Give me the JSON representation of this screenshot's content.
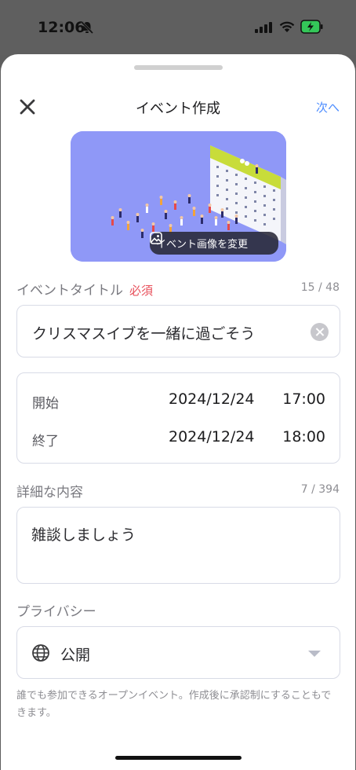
{
  "status": {
    "time": "12:06"
  },
  "header": {
    "title": "イベント作成",
    "next_label": "次へ"
  },
  "image": {
    "change_label": "イベント画像を変更"
  },
  "event_title": {
    "label": "イベントタイトル",
    "required": "必須",
    "counter": "15 / 48",
    "value": "クリスマスイブを一緒に過ごそう"
  },
  "schedule": {
    "start_label": "開始",
    "start_date": "2024/12/24",
    "start_time": "17:00",
    "end_label": "終了",
    "end_date": "2024/12/24",
    "end_time": "18:00"
  },
  "details": {
    "label": "詳細な内容",
    "counter": "7 / 394",
    "value": "雑談しましょう"
  },
  "privacy": {
    "label": "プライバシー",
    "selected": "公開",
    "note": "誰でも参加できるオープンイベント。作成後に承認制にすることもできます。"
  },
  "colors": {
    "accent": "#4d8dff",
    "required": "#e8505b",
    "hero_bg": "#8f98f7"
  }
}
